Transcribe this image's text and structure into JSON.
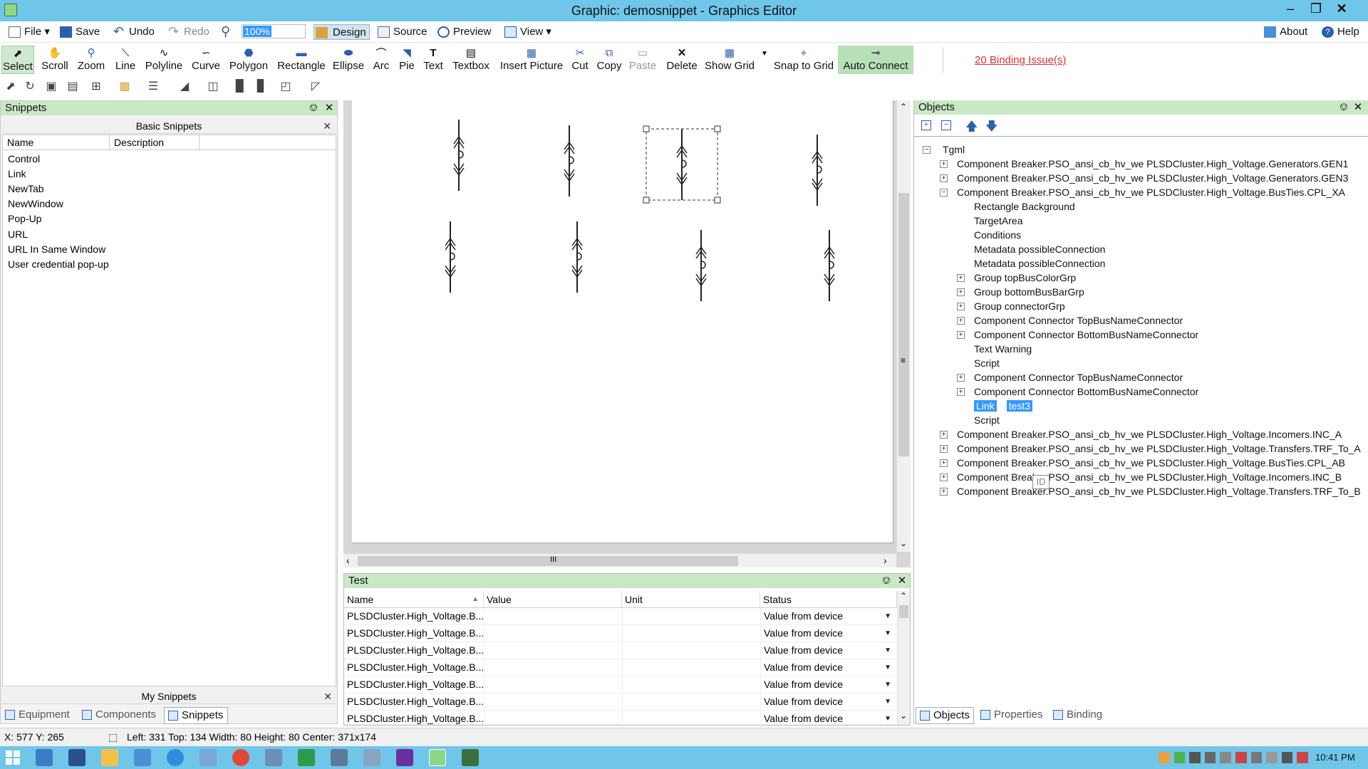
{
  "window": {
    "title": "Graphic: demosnippet - Graphics Editor"
  },
  "menu": {
    "file": "File",
    "save": "Save",
    "undo": "Undo",
    "redo": "Redo",
    "zoom_value": "100%",
    "design": "Design",
    "source": "Source",
    "preview": "Preview",
    "view": "View",
    "about": "About",
    "help": "Help"
  },
  "toolbar": {
    "tools": [
      "Select",
      "Scroll",
      "Zoom",
      "Line",
      "Polyline",
      "Curve",
      "Polygon",
      "Rectangle",
      "Ellipse",
      "Arc",
      "Pie",
      "Text",
      "Textbox",
      "Insert Picture",
      "Cut",
      "Copy",
      "Paste",
      "Delete",
      "Show Grid",
      "Snap to Grid",
      "Auto Connect"
    ],
    "binding_issues": "20 Binding Issue(s)"
  },
  "snippets": {
    "header": "Snippets",
    "basic_title": "Basic Snippets",
    "col_name": "Name",
    "col_description": "Description",
    "items": [
      "Control",
      "Link",
      "NewTab",
      "NewWindow",
      "Pop-Up",
      "URL",
      "URL In Same Window",
      "User credential pop-up"
    ],
    "my_title": "My Snippets",
    "tabs": [
      "Equipment",
      "Components",
      "Snippets"
    ]
  },
  "scroll": {
    "hthumb": "III",
    "vthumb": "≡"
  },
  "test": {
    "header": "Test",
    "columns": [
      "Name",
      "Value",
      "Unit",
      "Status"
    ],
    "rows": [
      {
        "name": "PLSDCluster.High_Voltage.B...",
        "value": "",
        "unit": "",
        "status": "Value from device"
      },
      {
        "name": "PLSDCluster.High_Voltage.B...",
        "value": "",
        "unit": "",
        "status": "Value from device"
      },
      {
        "name": "PLSDCluster.High_Voltage.B...",
        "value": "",
        "unit": "",
        "status": "Value from device"
      },
      {
        "name": "PLSDCluster.High_Voltage.B...",
        "value": "",
        "unit": "",
        "status": "Value from device"
      },
      {
        "name": "PLSDCluster.High_Voltage.B...",
        "value": "",
        "unit": "",
        "status": "Value from device"
      },
      {
        "name": "PLSDCluster.High_Voltage.B...",
        "value": "",
        "unit": "",
        "status": "Value from device"
      },
      {
        "name": "PLSDCluster.High_Voltage.B...",
        "value": "",
        "unit": "",
        "status": "Value from device"
      }
    ]
  },
  "objects": {
    "header": "Objects",
    "root": "Tgml",
    "tree": [
      {
        "level": 1,
        "expander": "+",
        "text": "Component Breaker.PSO_ansi_cb_hv_we  PLSDCluster.High_Voltage.Generators.GEN1"
      },
      {
        "level": 1,
        "expander": "+",
        "text": "Component Breaker.PSO_ansi_cb_hv_we  PLSDCluster.High_Voltage.Generators.GEN3"
      },
      {
        "level": 1,
        "expander": "-",
        "text": "Component Breaker.PSO_ansi_cb_hv_we  PLSDCluster.High_Voltage.BusTies.CPL_XA"
      },
      {
        "level": 2,
        "expander": "",
        "text": "Rectangle     Background"
      },
      {
        "level": 2,
        "expander": "",
        "text": "TargetArea"
      },
      {
        "level": 2,
        "expander": "",
        "text": "Conditions"
      },
      {
        "level": 2,
        "expander": "",
        "text": "Metadata     possibleConnection"
      },
      {
        "level": 2,
        "expander": "",
        "text": "Metadata     possibleConnection"
      },
      {
        "level": 2,
        "expander": "+",
        "text": "Group     topBusColorGrp"
      },
      {
        "level": 2,
        "expander": "+",
        "text": "Group     bottomBusBarGrp"
      },
      {
        "level": 2,
        "expander": "+",
        "text": "Group     connectorGrp"
      },
      {
        "level": 2,
        "expander": "+",
        "text": "Component  Connector  TopBusNameConnector"
      },
      {
        "level": 2,
        "expander": "+",
        "text": "Component  Connector  BottomBusNameConnector"
      },
      {
        "level": 2,
        "expander": "",
        "text": "Text     Warning"
      },
      {
        "level": 2,
        "expander": "",
        "text": "Script"
      },
      {
        "level": 2,
        "expander": "+",
        "text": "Component  Connector  TopBusNameConnector"
      },
      {
        "level": 2,
        "expander": "+",
        "text": "Component  Connector  BottomBusNameConnector"
      },
      {
        "level": 2,
        "expander": "",
        "text": "Link",
        "extra": "test3",
        "selected": true
      },
      {
        "level": 2,
        "expander": "",
        "text": "Script"
      },
      {
        "level": 1,
        "expander": "+",
        "text": "Component Breaker.PSO_ansi_cb_hv_we  PLSDCluster.High_Voltage.Incomers.INC_A"
      },
      {
        "level": 1,
        "expander": "+",
        "text": "Component Breaker.PSO_ansi_cb_hv_we  PLSDCluster.High_Voltage.Transfers.TRF_To_A"
      },
      {
        "level": 1,
        "expander": "+",
        "text": "Component Breaker.PSO_ansi_cb_hv_we  PLSDCluster.High_Voltage.BusTies.CPL_AB"
      },
      {
        "level": 1,
        "expander": "+",
        "text": "Component Breaker.PSO_ansi_cb_hv_we  PLSDCluster.High_Voltage.Incomers.INC_B"
      },
      {
        "level": 1,
        "expander": "+",
        "text": "Component Breaker.PSO_ansi_cb_hv_we  PLSDCluster.High_Voltage.Transfers.TRF_To_B"
      }
    ],
    "tooltip": "ID",
    "tabs": [
      "Objects",
      "Properties",
      "Binding"
    ]
  },
  "status": {
    "coords": "X: 577  Y: 265",
    "geometry": "Left: 331  Top: 134  Width: 80  Height: 80  Center: 371x174"
  },
  "taskbar": {
    "clock": "10:41 PM"
  }
}
